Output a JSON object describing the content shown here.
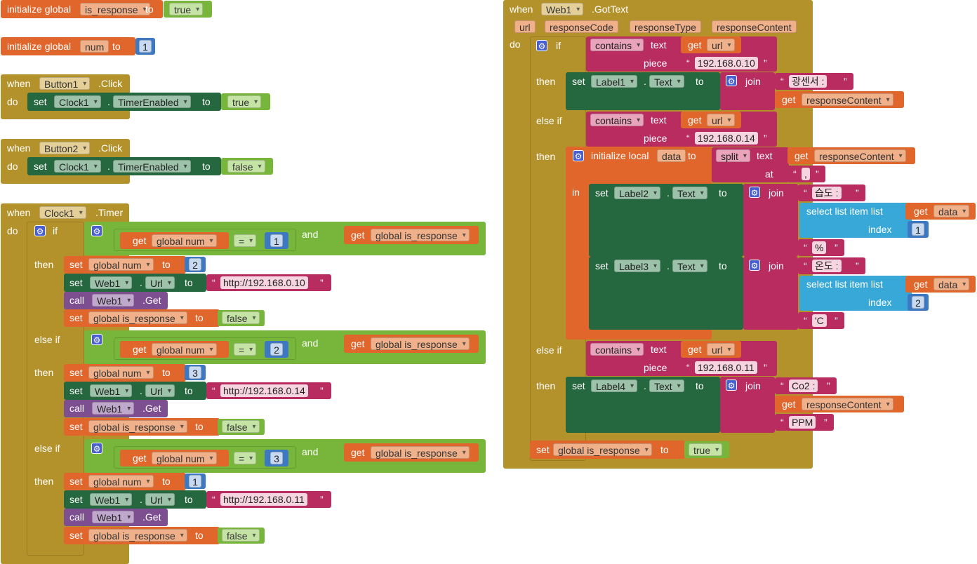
{
  "workspace": {
    "init_is_response": {
      "keyword": "initialize global",
      "name": "is_response",
      "to": "to",
      "value": "true"
    },
    "init_num": {
      "keyword": "initialize global",
      "name": "num",
      "to": "to",
      "value": "1"
    },
    "button1_click": {
      "when": "when",
      "component": "Button1",
      "event": ".Click",
      "do": "do",
      "set": "set",
      "target": "Clock1",
      "dot": ".",
      "prop": "TimerEnabled",
      "to": "to",
      "value": "true"
    },
    "button2_click": {
      "when": "when",
      "component": "Button2",
      "event": ".Click",
      "do": "do",
      "set": "set",
      "target": "Clock1",
      "dot": ".",
      "prop": "TimerEnabled",
      "to": "to",
      "value": "false"
    },
    "clock1_timer": {
      "when": "when",
      "component": "Clock1",
      "event": ".Timer",
      "do": "do",
      "if": "if",
      "else_if": "else if",
      "then": "then",
      "and": "and",
      "get": "get",
      "eq": "=",
      "set": "set",
      "to": "to",
      "call": "call",
      "dot": ".",
      "global_num": "global num",
      "global_is_response": "global is_response",
      "web": "Web1",
      "url_prop": "Url",
      "get_method": ".Get",
      "false": "false",
      "branches": [
        {
          "cond_num": "1",
          "set_num": "2",
          "url": "http://192.168.0.10"
        },
        {
          "cond_num": "2",
          "set_num": "3",
          "url": "http://192.168.0.14"
        },
        {
          "cond_num": "3",
          "set_num": "1",
          "url": "http://192.168.0.11"
        }
      ]
    },
    "web1_gottext": {
      "when": "when",
      "component": "Web1",
      "event": ".GotText",
      "do": "do",
      "params": [
        "url",
        "responseCode",
        "responseType",
        "responseContent"
      ],
      "if": "if",
      "else_if": "else if",
      "then": "then",
      "in": "in",
      "contains": "contains",
      "text": "text",
      "piece": "piece",
      "get": "get",
      "url": "url",
      "set": "set",
      "dot": ".",
      "to": "to",
      "join": "join",
      "response_content": "responseContent",
      "label_text": "Text",
      "q_open": "“",
      "q_close": "”",
      "branch1": {
        "piece": "192.168.0.10",
        "label": "Label1",
        "prefix": "광센서 :"
      },
      "branch2": {
        "piece": "192.168.0.14",
        "init_local": "initialize local",
        "local_name": "data",
        "split": "split",
        "at": "at",
        "sep": ",",
        "select": "select list item  list",
        "index": "index",
        "data": "data",
        "label2": "Label2",
        "label2_prefix": "습도 :",
        "label2_index": "1",
        "label2_suffix": "%",
        "label3": "Label3",
        "label3_prefix": "온도 :",
        "label3_index": "2",
        "label3_suffix": "'C"
      },
      "branch3": {
        "piece": "192.168.0.11",
        "label": "Label4",
        "prefix": "Co2 :",
        "suffix": "PPM"
      },
      "final_set": {
        "set": "set",
        "var": "global is_response",
        "to": "to",
        "value": "true"
      }
    }
  },
  "colors": {
    "global": "#e0662c",
    "event": "#b3922b",
    "setter": "#25673e",
    "logic": "#77b63b",
    "math": "#3c79c2",
    "text": "#b82c60",
    "procedure": "#7d4f91",
    "list": "#38a8d8"
  }
}
